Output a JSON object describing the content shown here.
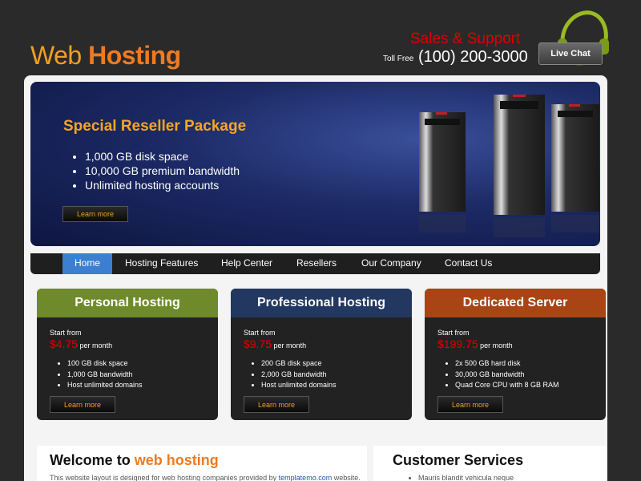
{
  "header": {
    "logo_part1": "Web ",
    "logo_part2": "Hosting",
    "sales_label": "Sales & Support",
    "toll_free_label": "Toll Free",
    "phone": "(100) 200-3000",
    "live_chat_label": "Live Chat"
  },
  "banner": {
    "title": "Special Reseller Package",
    "features": [
      "1,000 GB disk space",
      "10,000 GB premium bandwidth",
      "Unlimited hosting accounts"
    ],
    "button_label": "Learn more"
  },
  "nav": {
    "items": [
      {
        "label": "Home"
      },
      {
        "label": "Hosting Features"
      },
      {
        "label": "Help Center"
      },
      {
        "label": "Resellers"
      },
      {
        "label": "Our Company"
      },
      {
        "label": "Contact Us"
      }
    ]
  },
  "plans": [
    {
      "title": "Personal Hosting",
      "start_label": "Start from",
      "price": "$4.75",
      "per": " per month",
      "features": [
        "100 GB disk space",
        "1,000 GB bandwidth",
        "Host unlimited domains"
      ],
      "button_label": "Learn more"
    },
    {
      "title": "Professional Hosting",
      "start_label": "Start from",
      "price": "$9.75",
      "per": " per month",
      "features": [
        "200 GB disk space",
        "2,000 GB bandwidth",
        "Host unlimited domains"
      ],
      "button_label": "Learn more"
    },
    {
      "title": "Dedicated Server",
      "start_label": "Start from",
      "price": "$199.75",
      "per": " per month",
      "features": [
        "2x 500 GB hard disk",
        "30,000 GB bandwidth",
        "Quad Core CPU with 8 GB RAM"
      ],
      "button_label": "Learn more"
    }
  ],
  "colors": {
    "plan_head_1": "#6f8a2a",
    "plan_head_2": "#233860",
    "plan_head_3": "#a94414",
    "nav_active": "#3c7fd0"
  },
  "welcome": {
    "title_part1": "Welcome to ",
    "title_part2": "web hosting",
    "text_part1": "This website layout is designed for web hosting companies provided by ",
    "text_link": "templatemo.com",
    "text_part2": " website."
  },
  "customer_services": {
    "title": "Customer Services",
    "items": [
      "Mauris blandit vehicula neque"
    ]
  }
}
